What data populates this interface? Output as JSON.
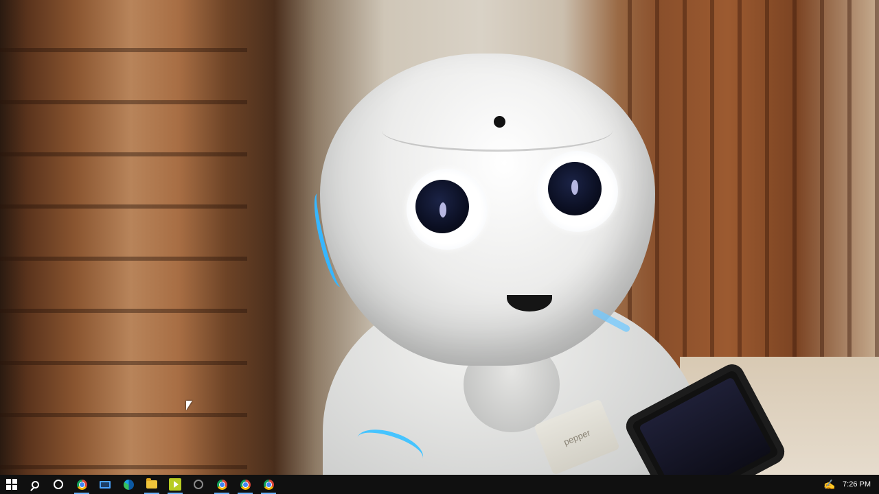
{
  "desktop": {
    "name_plate_text": "pepper"
  },
  "taskbar": {
    "items": [
      {
        "name": "start-button",
        "icon": "windows-logo-icon"
      },
      {
        "name": "search-button",
        "icon": "search-icon"
      },
      {
        "name": "task-view-button",
        "icon": "cortana-circle-icon"
      },
      {
        "name": "chrome-1",
        "icon": "chrome-icon"
      },
      {
        "name": "monitor-app",
        "icon": "monitor-icon"
      },
      {
        "name": "edge",
        "icon": "edge-icon"
      },
      {
        "name": "file-explorer",
        "icon": "folder-icon"
      },
      {
        "name": "media-player",
        "icon": "media-play-icon"
      },
      {
        "name": "clock-app",
        "icon": "clock-icon"
      },
      {
        "name": "chrome-2",
        "icon": "chrome-icon"
      },
      {
        "name": "chrome-3",
        "icon": "chrome-icon"
      },
      {
        "name": "chrome-4",
        "icon": "chrome-icon"
      }
    ],
    "clock": "7:26 PM"
  },
  "colors": {
    "taskbar_bg": "#101010",
    "accent": "#6bb4ff"
  }
}
